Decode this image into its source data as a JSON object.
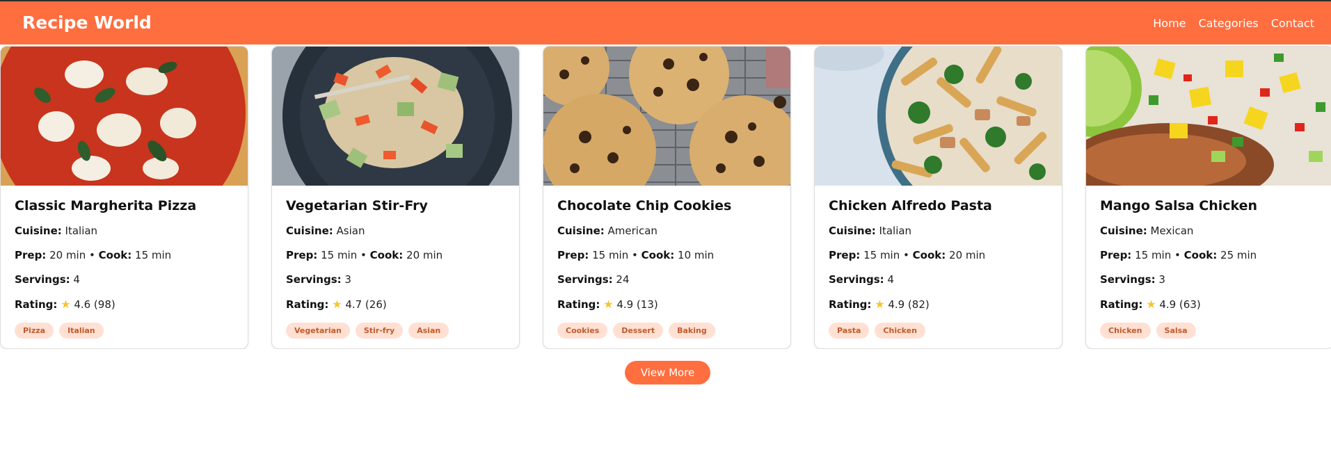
{
  "header": {
    "brand": "Recipe World",
    "nav": [
      "Home",
      "Categories",
      "Contact"
    ]
  },
  "colors": {
    "primary": "#ff6e3f",
    "tag_bg": "#ffe0d3",
    "tag_text": "#c05a2a",
    "star": "#f6c52b"
  },
  "labels": {
    "cuisine": "Cuisine:",
    "prep": "Prep:",
    "cook": "Cook:",
    "servings": "Servings:",
    "rating": "Rating:",
    "star_icon": "star-icon",
    "separator": "•"
  },
  "recipes": [
    {
      "title": "Classic Margherita Pizza",
      "cuisine": "Italian",
      "prep": "20 min",
      "cook": "15 min",
      "servings": "4",
      "rating": "4.6 (98)",
      "tags": [
        "Pizza",
        "Italian"
      ],
      "image": "margherita-pizza-photo"
    },
    {
      "title": "Vegetarian Stir-Fry",
      "cuisine": "Asian",
      "prep": "15 min",
      "cook": "20 min",
      "servings": "3",
      "rating": "4.7 (26)",
      "tags": [
        "Vegetarian",
        "Stir-fry",
        "Asian"
      ],
      "image": "vegetable-stir-fry-photo"
    },
    {
      "title": "Chocolate Chip Cookies",
      "cuisine": "American",
      "prep": "15 min",
      "cook": "10 min",
      "servings": "24",
      "rating": "4.9 (13)",
      "tags": [
        "Cookies",
        "Dessert",
        "Baking"
      ],
      "image": "chocolate-chip-cookies-photo"
    },
    {
      "title": "Chicken Alfredo Pasta",
      "cuisine": "Italian",
      "prep": "15 min",
      "cook": "20 min",
      "servings": "4",
      "rating": "4.9 (82)",
      "tags": [
        "Pasta",
        "Chicken"
      ],
      "image": "chicken-alfredo-pasta-photo"
    },
    {
      "title": "Mango Salsa Chicken",
      "cuisine": "Mexican",
      "prep": "15 min",
      "cook": "25 min",
      "servings": "3",
      "rating": "4.9 (63)",
      "tags": [
        "Chicken",
        "Salsa"
      ],
      "image": "mango-salsa-chicken-photo"
    }
  ],
  "actions": {
    "view_more": "View More"
  }
}
